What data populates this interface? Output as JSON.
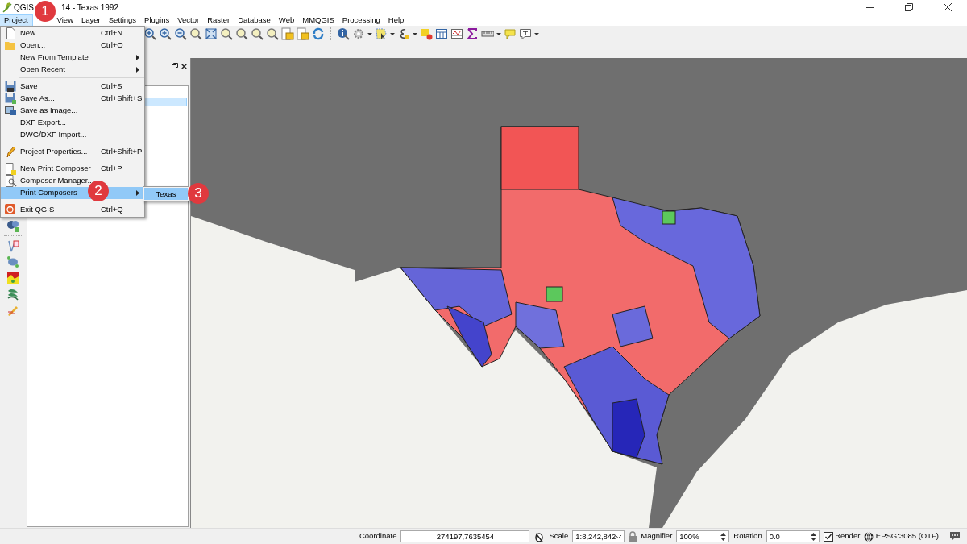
{
  "window": {
    "title_parts": [
      "QGIS",
      "14 - Texas 1992"
    ]
  },
  "menubar": [
    {
      "label": "Project",
      "selected": true
    },
    {
      "label": "View",
      "selected": false
    },
    {
      "label": "Layer",
      "selected": false
    },
    {
      "label": "Settings",
      "selected": false
    },
    {
      "label": "Plugins",
      "selected": false
    },
    {
      "label": "Vector",
      "selected": false
    },
    {
      "label": "Raster",
      "selected": false
    },
    {
      "label": "Database",
      "selected": false
    },
    {
      "label": "Web",
      "selected": false
    },
    {
      "label": "MMQGIS",
      "selected": false
    },
    {
      "label": "Processing",
      "selected": false
    },
    {
      "label": "Help",
      "selected": false
    }
  ],
  "project_menu": [
    {
      "kind": "item",
      "label": "New",
      "shortcut": "Ctrl+N",
      "submenu": false,
      "selected": false
    },
    {
      "kind": "item",
      "label": "Open...",
      "shortcut": "Ctrl+O",
      "submenu": false,
      "selected": false
    },
    {
      "kind": "item",
      "label": "New From Template",
      "submenu": true,
      "selected": false
    },
    {
      "kind": "item",
      "label": "Open Recent",
      "submenu": true,
      "selected": false
    },
    {
      "kind": "separator"
    },
    {
      "kind": "item",
      "label": "Save",
      "shortcut": "Ctrl+S",
      "submenu": false,
      "selected": false
    },
    {
      "kind": "item",
      "label": "Save As...",
      "shortcut": "Ctrl+Shift+S",
      "submenu": false,
      "selected": false
    },
    {
      "kind": "item",
      "label": "Save as Image...",
      "submenu": false,
      "selected": false
    },
    {
      "kind": "item",
      "label": "DXF Export...",
      "submenu": false,
      "selected": false
    },
    {
      "kind": "item",
      "label": "DWG/DXF Import...",
      "submenu": false,
      "selected": false
    },
    {
      "kind": "separator"
    },
    {
      "kind": "item",
      "label": "Project Properties...",
      "shortcut": "Ctrl+Shift+P",
      "submenu": false,
      "selected": false
    },
    {
      "kind": "separator"
    },
    {
      "kind": "item",
      "label": "New Print Composer",
      "shortcut": "Ctrl+P",
      "submenu": false,
      "selected": false
    },
    {
      "kind": "item",
      "label": "Composer Manager...",
      "submenu": false,
      "selected": false
    },
    {
      "kind": "item",
      "label": "Print Composers",
      "submenu": true,
      "selected": true
    },
    {
      "kind": "separator"
    },
    {
      "kind": "item",
      "label": "Exit QGIS",
      "shortcut": "Ctrl+Q",
      "submenu": false,
      "selected": false
    }
  ],
  "submenu": [
    {
      "label": "Texas",
      "selected": true
    }
  ],
  "callouts": [
    "1",
    "2",
    "3"
  ],
  "layers_panel": {
    "rows": [
      {
        "selected": true
      }
    ]
  },
  "status_bar": {
    "coordinate_label": "Coordinate",
    "coordinate": "274197,7635454",
    "scale_label": "Scale",
    "scale": "1:8,242,842",
    "magnifier_label": "Magnifier",
    "magnifier": "100%",
    "rotation_label": "Rotation",
    "rotation": "0.0",
    "render": {
      "label": "Render",
      "checked": true
    },
    "crs": "EPSG:3085 (OTF)"
  }
}
